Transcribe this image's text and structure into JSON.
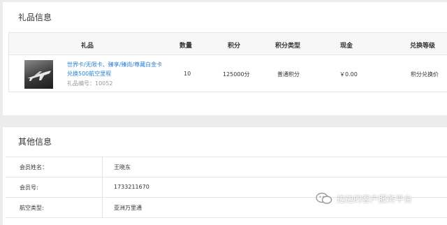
{
  "gift_section": {
    "title": "礼品信息",
    "columns": {
      "gift": "礼品",
      "quantity": "数量",
      "points": "积分",
      "points_type": "积分类型",
      "cash": "现金",
      "exchange_level": "兑换等级"
    },
    "row": {
      "thumbnail_icon": "airplane-icon",
      "name": "世界卡/无限卡、臻享/臻尚/尊藏白金卡兑换500航空里程",
      "code": "礼品编号：10052",
      "quantity": "10",
      "points": "125000分",
      "points_type": "普通积分",
      "cash": "￥0.00",
      "exchange_level": "积分兑换价"
    }
  },
  "other_section": {
    "title": "其他信息",
    "rows": [
      {
        "label": "会员姓名：",
        "value": "王晓东"
      },
      {
        "label": "会员号:",
        "value": "1733211670"
      },
      {
        "label": "航空类型:",
        "value": "亚洲万里通"
      }
    ]
  },
  "watermark": {
    "icon": "wechat-icon",
    "text": "边边的客户服务平台"
  },
  "colors": {
    "link": "#2a7fd6",
    "background": "#ececec",
    "header_bg": "#f7f7f7"
  }
}
